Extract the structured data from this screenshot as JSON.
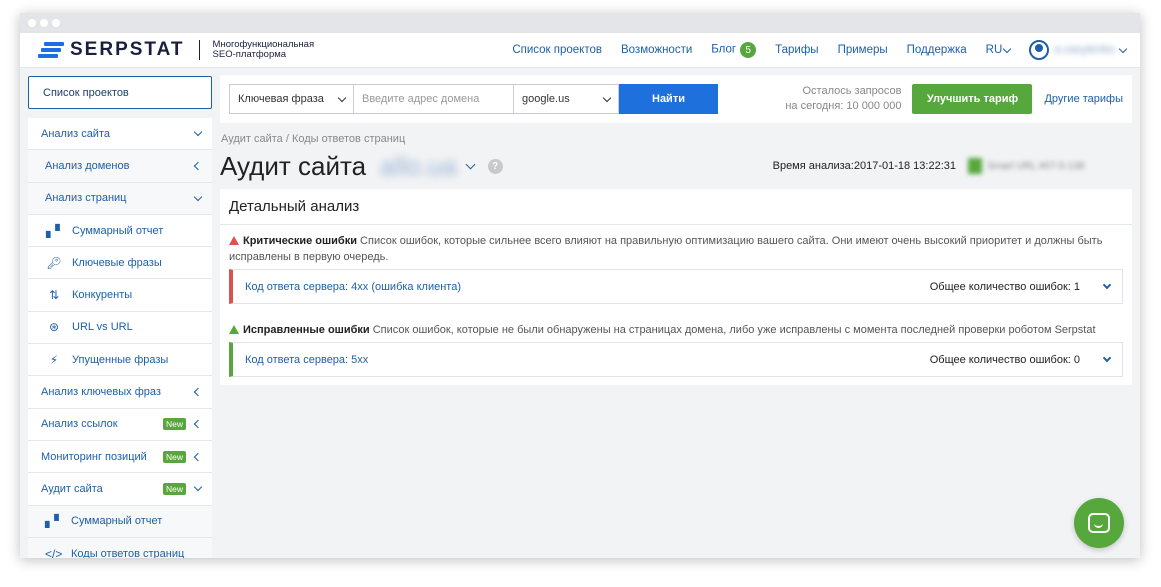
{
  "brand": {
    "name": "SERPSTAT",
    "tagline_line1": "Многофункциональная",
    "tagline_line2": "SEO-платформа",
    "accent": "#1c6ee8"
  },
  "topnav": {
    "projects": "Список проектов",
    "features": "Возможности",
    "blog": "Блог",
    "blog_badge": "5",
    "pricing": "Тарифы",
    "examples": "Примеры",
    "support": "Поддержка",
    "lang": "RU",
    "user_name": "a.vasylenko"
  },
  "sidebar": {
    "project_button": "Список проектов",
    "items": [
      {
        "label": "Анализ сайта",
        "level": "top",
        "arrow": "down"
      },
      {
        "label": "Анализ доменов",
        "level": "sub",
        "arrow": "left"
      },
      {
        "label": "Анализ страниц",
        "level": "sub",
        "arrow": "down"
      },
      {
        "label": "Суммарный отчет",
        "level": "subsub",
        "icon": "bar-chart-icon"
      },
      {
        "label": "Ключевые фразы",
        "level": "subsub",
        "icon": "key-icon"
      },
      {
        "label": "Конкуренты",
        "level": "subsub",
        "icon": "sort-arrows-icon"
      },
      {
        "label": "URL vs URL",
        "level": "subsub",
        "icon": "compare-icon"
      },
      {
        "label": "Упущенные фразы",
        "level": "subsub",
        "icon": "running-icon"
      },
      {
        "label": "Анализ ключевых фраз",
        "level": "top",
        "arrow": "left"
      },
      {
        "label": "Анализ ссылок",
        "level": "top",
        "arrow": "left",
        "badge": "New"
      },
      {
        "label": "Мониторинг позиций",
        "level": "top",
        "arrow": "left",
        "badge": "New"
      },
      {
        "label": "Аудит сайта",
        "level": "top",
        "arrow": "down",
        "badge": "New"
      },
      {
        "label": "Суммарный отчет",
        "level": "sub",
        "icon": "bar-chart-icon"
      },
      {
        "label": "Коды ответов страниц",
        "level": "sub",
        "icon": "code-icon"
      }
    ]
  },
  "search": {
    "type_select": "Ключевая фраза",
    "domain_placeholder": "Введите адрес домена",
    "engine_select": "google.us",
    "find_button": "Найти",
    "quota_line1": "Осталось запросов",
    "quota_line2": "на сегодня: 10 000 000",
    "upgrade_button": "Улучшить тариф",
    "other_plans": "Другие тарифы"
  },
  "page": {
    "breadcrumb": "Аудит сайта / Коды ответов страниц",
    "title": "Аудит сайта",
    "domain": "allo.ua",
    "help": "?",
    "analysis_time": "Время анализа:2017-01-18 13:22:31",
    "user_agent": "Smart URL #07-5-138"
  },
  "panel": {
    "title": "Детальный анализ",
    "critical": {
      "heading": "Критические ошибки",
      "text": " Список ошибок, которые сильнее всего влияют на правильную оптимизацию вашего сайта. Они имеют очень высокий приоритет и должны быть исправлены в первую очередь.",
      "row_label": "Код ответа сервера: 4xx (ошибка клиента)",
      "row_count": "Общее количество ошибок: 1"
    },
    "fixed": {
      "heading": "Исправленные ошибки",
      "text": " Список ошибок, которые не были обнаружены на страницах домена, либо уже исправлены с момента последней проверки роботом Serpstat",
      "row_label": "Код ответа сервера: 5xx",
      "row_count": "Общее количество ошибок: 0"
    }
  },
  "colors": {
    "link": "#1d5fa8",
    "green": "#56a83c",
    "red": "#d9534f",
    "button_blue": "#1e70dc"
  }
}
